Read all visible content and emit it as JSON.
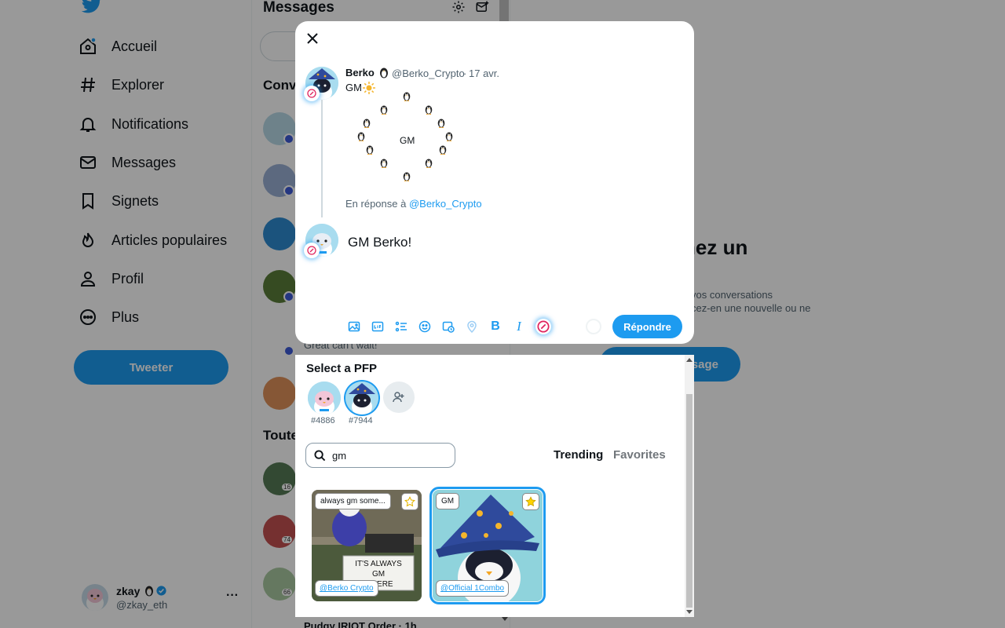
{
  "sidebar": {
    "nav": [
      {
        "label": "Accueil",
        "icon": "home-icon"
      },
      {
        "label": "Explorer",
        "icon": "hashtag-icon"
      },
      {
        "label": "Notifications",
        "icon": "bell-icon"
      },
      {
        "label": "Messages",
        "icon": "envelope-icon"
      },
      {
        "label": "Signets",
        "icon": "bookmark-icon"
      },
      {
        "label": "Articles populaires",
        "icon": "flame-icon"
      },
      {
        "label": "Profil",
        "icon": "person-icon"
      },
      {
        "label": "Plus",
        "icon": "more-circle-icon"
      }
    ],
    "tweet_label": "Tweeter",
    "account": {
      "name": "zkay",
      "handle": "@zkay_eth",
      "more": "···"
    }
  },
  "messages": {
    "title": "Messages",
    "conversations_head": "Conv",
    "all_head": "Toute",
    "snippet": "Great can't wait!",
    "counts": [
      "16",
      "74",
      "66"
    ],
    "bottom_row": "Pudgy IRIOT Order · 1h"
  },
  "empty_state": {
    "title": "nez un",
    "line1": "vos conversations",
    "line2": "cez-en une nouvelle ou ne",
    "button": "sage"
  },
  "modal": {
    "close_label": "×",
    "tweet": {
      "author": "Berko",
      "handle": "@Berko_Crypto",
      "separator": "·",
      "date": "17 avr.",
      "text": "GM",
      "art_center": "GM"
    },
    "reply_prefix": "En réponse à ",
    "reply_handle": "@Berko_Crypto",
    "compose_text": "GM Berko!",
    "toolbar": {
      "bold": "B",
      "italic": "I"
    },
    "reply_button": "Répondre"
  },
  "picker": {
    "title": "Select a PFP",
    "pfps": [
      {
        "number": "#4886",
        "selected": false
      },
      {
        "number": "#7944",
        "selected": true
      }
    ],
    "search_value": "gm",
    "search_placeholder": "",
    "tabs": [
      "Trending",
      "Favorites"
    ],
    "active_tab": "Trending",
    "gifs": [
      {
        "label": "always gm some...",
        "caption_lines": [
          "IT'S ALWAYS",
          "GM",
          "WHERE"
        ],
        "credit": "@Berko Crypto",
        "favorited": false
      },
      {
        "label": "GM",
        "credit": "@Official 1Combo",
        "favorited": true
      }
    ]
  },
  "colors": {
    "accent": "#1d9bf0",
    "star": "#ffd400",
    "overlay": "rgba(0,0,0,0.40)"
  }
}
